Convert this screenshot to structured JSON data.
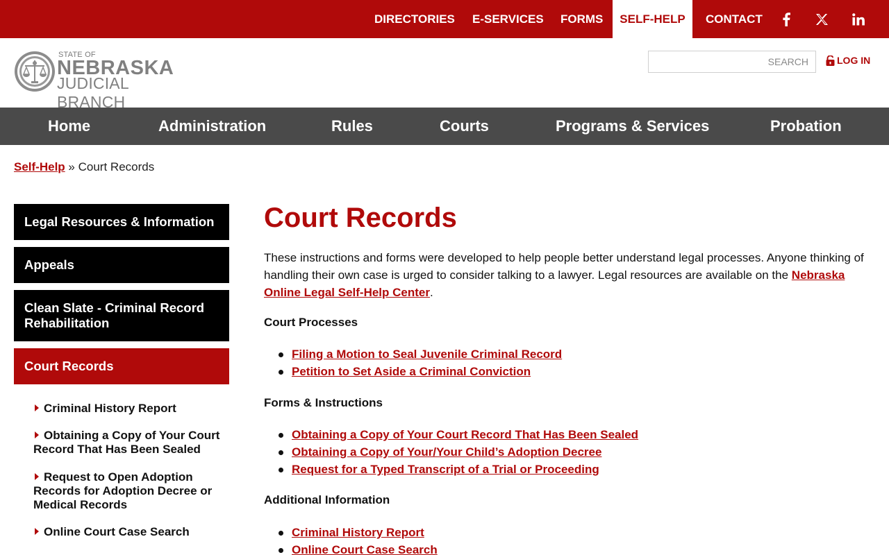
{
  "topnav": {
    "directories": "DIRECTORIES",
    "eservices": "E-SERVICES",
    "forms": "FORMS",
    "selfhelp": "SELF-HELP",
    "contact": "CONTACT",
    "social": [
      "facebook-icon",
      "x-icon",
      "linkedin-icon"
    ]
  },
  "logo": {
    "state_of": "STATE OF",
    "line1": "NEBRASKA",
    "line2": "JUDICIAL BRANCH"
  },
  "search": {
    "placeholder": "SEARCH"
  },
  "login": {
    "label": "LOG IN"
  },
  "mainnav": {
    "home": "Home",
    "administration": "Administration",
    "rules": "Rules",
    "courts": "Courts",
    "programs": "Programs & Services",
    "probation": "Probation"
  },
  "breadcrumb": {
    "parent": "Self-Help",
    "separator": "»",
    "current": "Court Records"
  },
  "sidebar": {
    "items": [
      {
        "label": "Legal Resources & Information"
      },
      {
        "label": "Appeals"
      },
      {
        "label": "Clean Slate - Criminal Record Rehabilitation"
      },
      {
        "label": "Court Records"
      }
    ],
    "subitems": [
      {
        "label": "Criminal History Report"
      },
      {
        "label": "Obtaining a Copy of Your Court Record That Has Been Sealed"
      },
      {
        "label": "Request to Open Adoption Records for Adoption Decree or Medical Records"
      },
      {
        "label": "Online Court Case Search"
      }
    ]
  },
  "content": {
    "title": "Court Records",
    "intro_text": "These instructions and forms were developed to help people better understand legal processes. Anyone thinking of handling their own case is urged to consider talking to a lawyer. Legal resources are available on the ",
    "intro_link": "Nebraska Online Legal Self-Help Center",
    "intro_end": ".",
    "sections": [
      {
        "heading": "Court Processes",
        "links": [
          "Filing a Motion to Seal Juvenile Criminal Record",
          "Petition to Set Aside a Criminal Conviction"
        ]
      },
      {
        "heading": "Forms & Instructions",
        "links": [
          "Obtaining a Copy of Your Court Record That Has Been Sealed",
          "Obtaining a Copy of Your/Your Child’s Adoption Decree",
          "Request for a Typed Transcript of a Trial or Proceeding"
        ]
      },
      {
        "heading": "Additional Information",
        "links": [
          "Criminal History Report",
          "Online Court Case Search"
        ]
      }
    ]
  },
  "colors": {
    "brand_red": "#b00a0a",
    "nav_gray": "#4a4a4a",
    "sidebar_black": "#000000"
  }
}
